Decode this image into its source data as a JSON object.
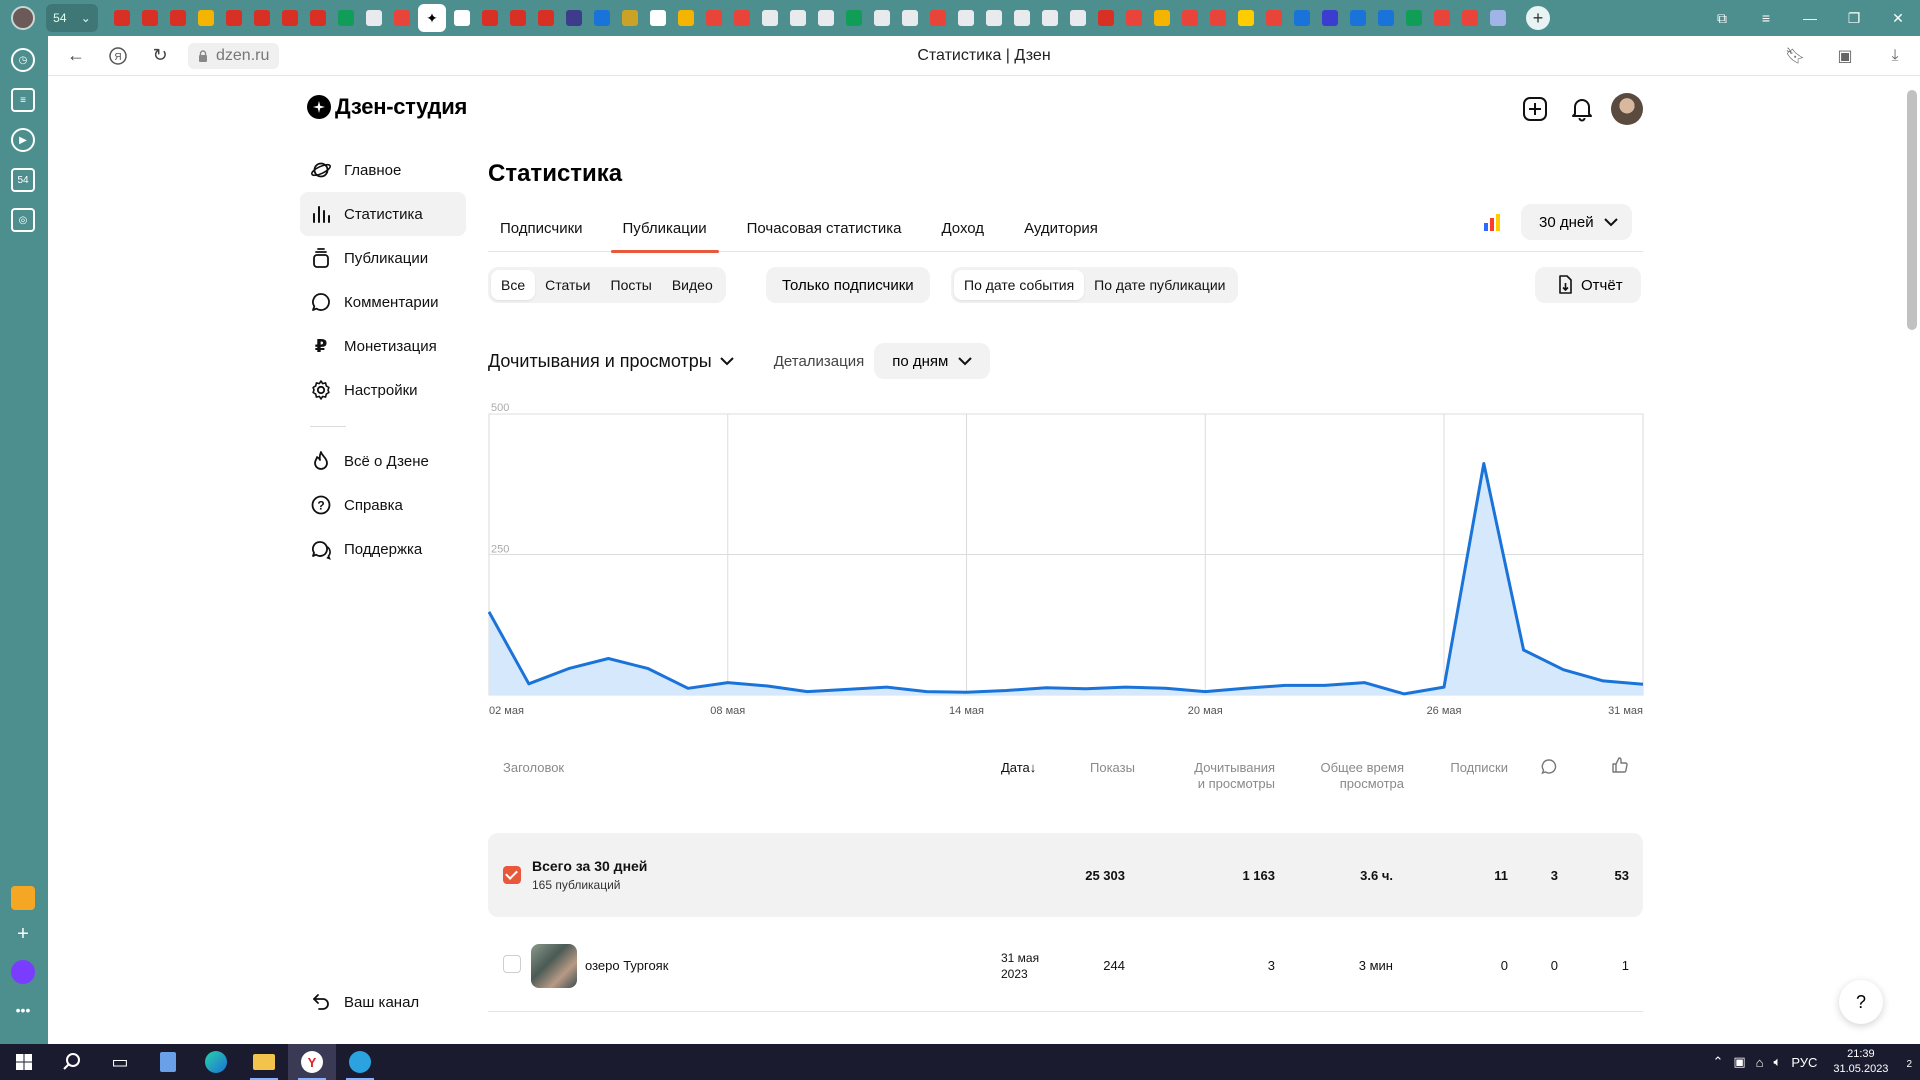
{
  "browser": {
    "url": "dzen.ru",
    "tab_title": "Статистика | Дзен",
    "tab_group_count": "54",
    "rail_badge": "54"
  },
  "studio": {
    "brand": "Дзен-студия"
  },
  "sidebar": {
    "items": [
      {
        "label": "Главное",
        "icon": "planet-icon"
      },
      {
        "label": "Статистика",
        "icon": "bar-chart-icon"
      },
      {
        "label": "Публикации",
        "icon": "stack-icon"
      },
      {
        "label": "Комментарии",
        "icon": "comment-icon"
      },
      {
        "label": "Монетизация",
        "icon": "ruble-icon"
      },
      {
        "label": "Настройки",
        "icon": "gear-icon"
      }
    ],
    "secondary": [
      {
        "label": "Всё о Дзене",
        "icon": "flame-icon"
      },
      {
        "label": "Справка",
        "icon": "question-icon"
      },
      {
        "label": "Поддержка",
        "icon": "chat-icon"
      }
    ],
    "channel_link": "Ваш канал"
  },
  "main": {
    "title": "Статистика",
    "tabs": [
      "Подписчики",
      "Публикации",
      "Почасовая статистика",
      "Доход",
      "Аудитория"
    ],
    "active_tab": "Публикации",
    "period": "30 дней",
    "content_filters": [
      "Все",
      "Статьи",
      "Посты",
      "Видео"
    ],
    "only_subscribers": "Только подписчики",
    "date_modes": [
      "По дате события",
      "По дате публикации"
    ],
    "report_button": "Отчёт",
    "metric": "Дочитывания и просмотры",
    "detail_label": "Детализация",
    "detail_value": "по дням"
  },
  "chart_data": {
    "type": "area",
    "title": "",
    "xlabel": "",
    "ylabel": "",
    "ylim": [
      0,
      500
    ],
    "yticks": [
      "0",
      "250",
      "500"
    ],
    "x": [
      "02 мая",
      "03 мая",
      "04 мая",
      "05 мая",
      "06 мая",
      "07 мая",
      "08 мая",
      "09 мая",
      "10 мая",
      "11 мая",
      "12 мая",
      "13 мая",
      "14 мая",
      "15 мая",
      "16 мая",
      "17 мая",
      "18 мая",
      "19 мая",
      "20 мая",
      "21 мая",
      "22 мая",
      "23 мая",
      "24 мая",
      "25 мая",
      "26 мая",
      "27 мая",
      "28 мая",
      "29 мая",
      "30 мая",
      "31 мая"
    ],
    "xtick_labels": [
      "02 мая",
      "08 мая",
      "14 мая",
      "20 мая",
      "26 мая",
      "31 мая"
    ],
    "series": [
      {
        "values": [
          148,
          20,
          47,
          65,
          47,
          12,
          22,
          16,
          6,
          10,
          14,
          6,
          5,
          8,
          13,
          11,
          14,
          12,
          6,
          12,
          17,
          17,
          22,
          2,
          14,
          412,
          80,
          45,
          25,
          19
        ]
      }
    ],
    "grid": true,
    "colors": {
      "line": "#1a73d9",
      "fill": "#d6e8fb"
    }
  },
  "table": {
    "headers": {
      "title": "Заголовок",
      "date": "Дата",
      "date_sort": "↓",
      "impressions": "Показы",
      "reads_line1": "Дочитывания",
      "reads_line2": "и просмотры",
      "time_line1": "Общее время",
      "time_line2": "просмотра",
      "subs": "Подписки",
      "comments_icon": "comment-icon",
      "likes_icon": "thumbs-up-icon"
    },
    "total": {
      "title": "Всего за 30 дней",
      "subtitle": "165 публикаций",
      "impressions": "25 303",
      "reads": "1 163",
      "time": "3.6 ч.",
      "subs": "11",
      "comments": "3",
      "likes": "53"
    },
    "rows": [
      {
        "title": "озеро Тургояк",
        "date_line1": "31 мая",
        "date_line2": "2023",
        "impressions": "244",
        "reads": "3",
        "time": "3 мин",
        "subs": "0",
        "comments": "0",
        "likes": "1"
      }
    ]
  },
  "help": "?",
  "taskbar": {
    "lang": "РУС",
    "time": "21:39",
    "date": "31.05.2023",
    "notifications": "2"
  },
  "colors": {
    "accent": "#e8583a",
    "chrome": "#4d8f8f",
    "chart_line": "#1a73d9"
  }
}
